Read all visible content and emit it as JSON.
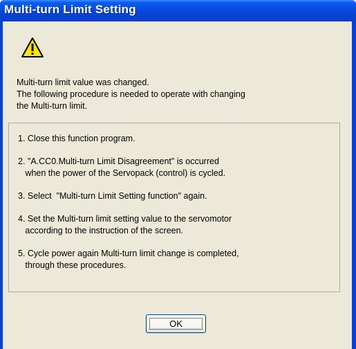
{
  "window": {
    "title": "Multi-turn Limit Setting"
  },
  "icon": "warning-icon",
  "message": {
    "line1": "Multi-turn limit value was changed.",
    "line2": "The following procedure is needed to operate with changing",
    "line3": "the Multi-turn limit."
  },
  "steps": {
    "s1": "1. Close this function program.",
    "s2a": "2. \"A.CC0.Multi-turn Limit Disagreement\" is occurred",
    "s2b": "   when the power of the Servopack (control) is cycled.",
    "s3": "3. Select  \"Multi-turn Limit Setting function\" again.",
    "s4a": "4. Set the Multi-turn limit setting value to the servomotor",
    "s4b": "   according to the instruction of the screen.",
    "s5a": "5. Cycle power again Multi-turn limit change is completed,",
    "s5b": "   through these procedures."
  },
  "buttons": {
    "ok_label": "OK"
  },
  "colors": {
    "titlebar": "#0546d8",
    "client": "#ece9d8",
    "warning_fill": "#ffe600"
  }
}
